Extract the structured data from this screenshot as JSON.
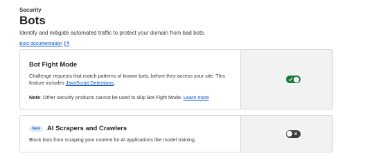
{
  "header": {
    "section_label": "Security",
    "title": "Bots",
    "subtitle": "Identify and mitigate automated traffic to protect your domain from bad bots.",
    "doc_link": "Bots documentation"
  },
  "cards": [
    {
      "title": "Bot Fight Mode",
      "desc_prefix": "Challenge requests that match patterns of known bots, before they access your site. This feature includes ",
      "desc_link": "JavaScript Detections",
      "desc_suffix": ".",
      "note_label": "Note",
      "note_text": ": Other security products cannot be used to skip Bot Fight Mode. ",
      "note_link": "Learn more",
      "toggle_state": "on"
    },
    {
      "badge": "New",
      "title": "AI Scrapers and Crawlers",
      "desc": "Block bots from scraping your content for AI applications like model training.",
      "toggle_state": "off"
    }
  ],
  "colors": {
    "link": "#0051c3",
    "toggle_on": "#1b7a3a",
    "toggle_off": "#3d3d3d",
    "side_panel": "#f2f2f2"
  },
  "icons": [
    "external-link-icon",
    "checkmark-icon",
    "close-icon"
  ]
}
